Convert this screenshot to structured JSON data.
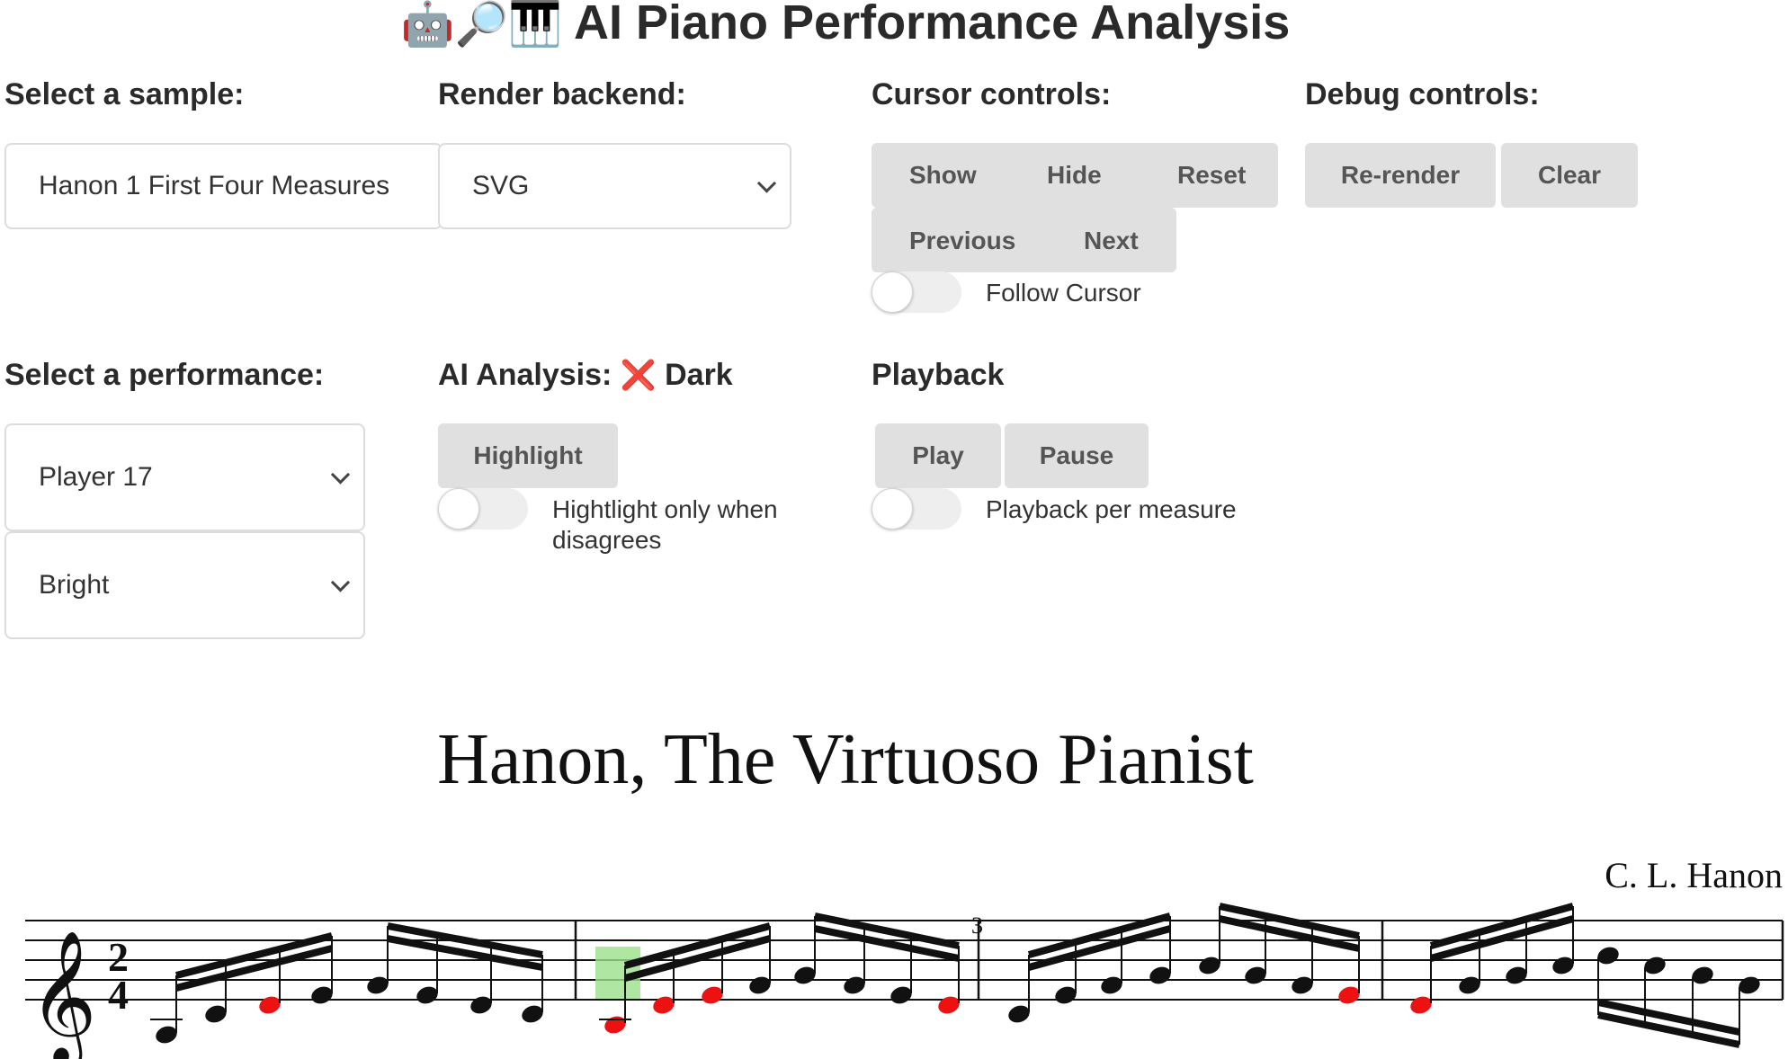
{
  "app": {
    "title": "AI Piano Performance Analysis",
    "title_emoji": "🤖🔎🎹"
  },
  "sample": {
    "label": "Select a sample:",
    "value": "Hanon 1 First Four Measures"
  },
  "render": {
    "label": "Render backend:",
    "value": "SVG"
  },
  "cursor": {
    "label": "Cursor controls:",
    "show": "Show",
    "hide": "Hide",
    "reset": "Reset",
    "previous": "Previous",
    "next": "Next",
    "follow_label": "Follow Cursor",
    "follow_on": false
  },
  "debug": {
    "label": "Debug controls:",
    "rerender": "Re-render",
    "clear": "Clear"
  },
  "performance": {
    "label": "Select a performance:",
    "player": "Player 17",
    "tone": "Bright"
  },
  "analysis": {
    "label": "AI Analysis:",
    "status_icon": "❌",
    "status_text": "Dark",
    "highlight": "Highlight",
    "toggle_label": "Hightlight only when disagrees",
    "toggle_on": false
  },
  "playback": {
    "label": "Playback",
    "play": "Play",
    "pause": "Pause",
    "toggle_label": "Playback per measure",
    "toggle_on": false
  },
  "score": {
    "title": "Hanon, The Virtuoso Pianist",
    "composer": "C. L. Hanon",
    "time_signature": [
      "2",
      "4"
    ],
    "measure_number": "3",
    "colors": {
      "error_note": "#ee1111",
      "normal_note": "#111111",
      "cursor": "#9be08a"
    }
  }
}
